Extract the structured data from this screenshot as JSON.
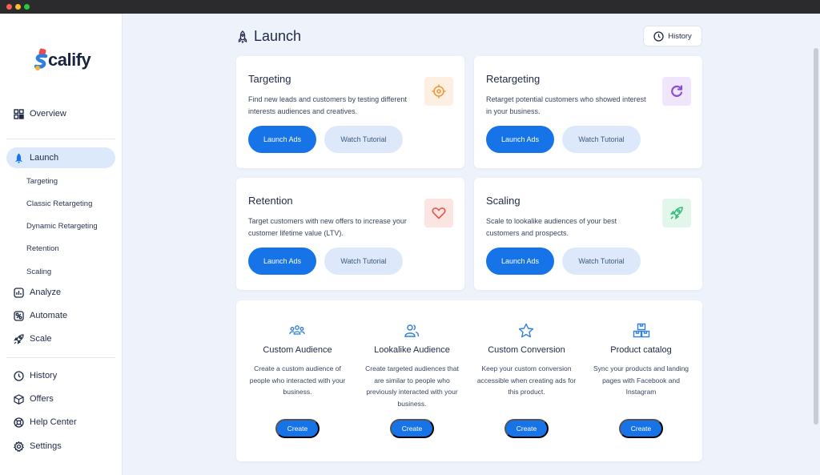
{
  "app": {
    "name": "calify"
  },
  "sidebar": {
    "overview": "Overview",
    "launch": "Launch",
    "sub_items": [
      "Targeting",
      "Classic Retargeting",
      "Dynamic Retargeting",
      "Retention",
      "Scaling"
    ],
    "analyze": "Analyze",
    "automate": "Automate",
    "scale": "Scale",
    "history": "History",
    "offers": "Offers",
    "help_center": "Help Center",
    "settings": "Settings"
  },
  "header": {
    "title": "Launch",
    "history_button": "History"
  },
  "cards": [
    {
      "title": "Targeting",
      "description": "Find new leads and customers by testing different interests audiences and creatives.",
      "primary": "Launch Ads",
      "secondary": "Watch Tutorial",
      "icon": "crosshair-icon",
      "badge_color": "#fdf0e2",
      "icon_color": "#f29a3a"
    },
    {
      "title": "Retargeting",
      "description": "Retarget potential customers who showed interest in your business.",
      "primary": "Launch Ads",
      "secondary": "Watch Tutorial",
      "icon": "refresh-icon",
      "badge_color": "#efe6fb",
      "icon_color": "#8a4fd6"
    },
    {
      "title": "Retention",
      "description": "Target customers with new offers to increase your customer lifetime value (LTV).",
      "primary": "Launch Ads",
      "secondary": "Watch Tutorial",
      "icon": "heart-icon",
      "badge_color": "#fbe5e3",
      "icon_color": "#e0594f"
    },
    {
      "title": "Scaling",
      "description": "Scale to lookalike audiences of your best customers and prospects.",
      "primary": "Launch Ads",
      "secondary": "Watch Tutorial",
      "icon": "rocket-icon",
      "badge_color": "#e2f6ec",
      "icon_color": "#36b87a"
    }
  ],
  "tools": [
    {
      "title": "Custom Audience",
      "description": "Create a custom audience of people who interacted with your business.",
      "button": "Create",
      "icon": "group-icon"
    },
    {
      "title": "Lookalike Audience",
      "description": "Create targeted audiences that are similar to people who previously interacted with your business.",
      "button": "Create",
      "icon": "users-icon"
    },
    {
      "title": "Custom Conversion",
      "description": "Keep your custom conversion accessible when creating ads for this product.",
      "button": "Create",
      "icon": "star-icon"
    },
    {
      "title": "Product catalog",
      "description": "Sync your products and landing pages with Facebook and Instagram",
      "button": "Create",
      "icon": "boxes-icon"
    }
  ],
  "colors": {
    "accent": "#1674e8",
    "tool_icon": "#2f7fdc"
  }
}
